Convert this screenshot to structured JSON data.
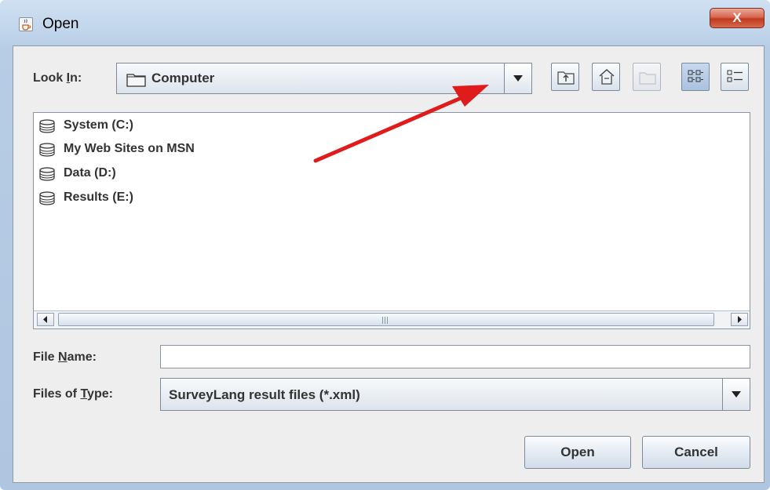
{
  "window": {
    "title": "Open",
    "close_label": "X"
  },
  "look_in": {
    "label_pre": "Look ",
    "label_mnemonic": "I",
    "label_post": "n:",
    "selected": "Computer"
  },
  "toolbar": {
    "icons": [
      "up-one-level-icon",
      "home-icon",
      "new-folder-icon",
      "list-view-icon",
      "details-view-icon"
    ]
  },
  "file_list": {
    "items": [
      {
        "label": "System (C:)",
        "icon": "drive-icon"
      },
      {
        "label": "My Web Sites on MSN",
        "icon": "drive-icon"
      },
      {
        "label": "Data (D:)",
        "icon": "drive-icon"
      },
      {
        "label": "Results (E:)",
        "icon": "drive-icon"
      }
    ]
  },
  "file_name": {
    "label_pre": "File ",
    "label_mnemonic": "N",
    "label_post": "ame:",
    "value": ""
  },
  "file_type": {
    "label_pre": "Files of ",
    "label_mnemonic": "T",
    "label_post": "ype:",
    "selected": "SurveyLang result files (*.xml)"
  },
  "buttons": {
    "open": "Open",
    "cancel": "Cancel"
  },
  "annotation": {
    "color": "#e01b1b"
  }
}
